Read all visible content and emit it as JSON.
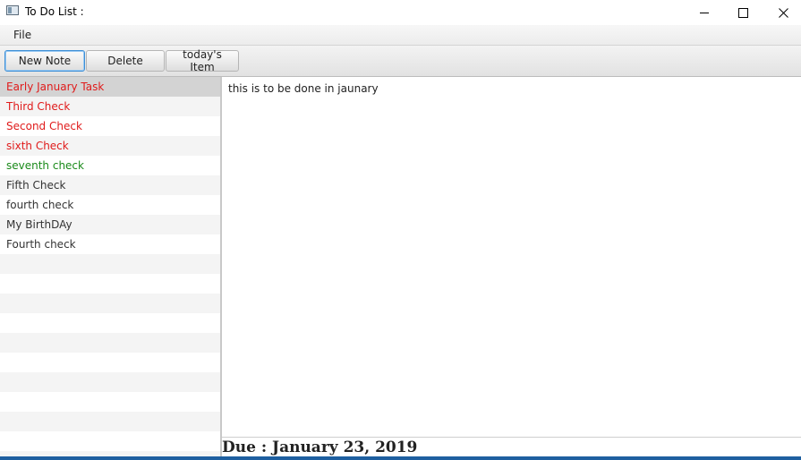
{
  "window": {
    "title": "To Do List :"
  },
  "menu": {
    "file": "File"
  },
  "toolbar": {
    "new_note": "New Note",
    "delete": "Delete",
    "todays_item": "today's Item"
  },
  "todo_list": {
    "items": [
      {
        "label": "Early January Task",
        "color": "#e01b1b",
        "selected": true
      },
      {
        "label": "Third Check",
        "color": "#e01b1b"
      },
      {
        "label": "Second Check",
        "color": "#e01b1b"
      },
      {
        "label": "sixth Check",
        "color": "#e01b1b"
      },
      {
        "label": "seventh check",
        "color": "#1a8a1a"
      },
      {
        "label": "Fifth Check",
        "color": "#333333"
      },
      {
        "label": "fourth check",
        "color": "#333333"
      },
      {
        "label": "My BirthDAy",
        "color": "#333333"
      },
      {
        "label": "Fourth check",
        "color": "#333333"
      }
    ]
  },
  "detail": {
    "text": "this is to be done in jaunary"
  },
  "due": {
    "label": "Due : January 23, 2019"
  }
}
